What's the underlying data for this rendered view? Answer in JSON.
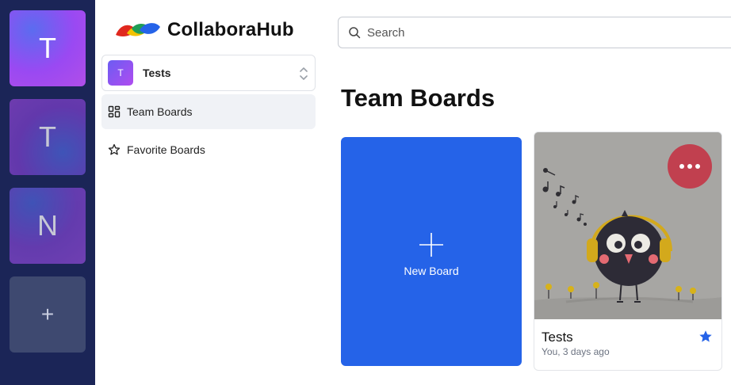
{
  "orgs": [
    {
      "initial": "T"
    },
    {
      "initial": "T"
    },
    {
      "initial": "N"
    }
  ],
  "add_org_symbol": "+",
  "brand": {
    "name": "CollaboraHub"
  },
  "current_org": {
    "initial": "T",
    "name": "Tests"
  },
  "nav": [
    {
      "label": "Team Boards",
      "icon": "dashboard-icon",
      "active": true
    },
    {
      "label": "Favorite Boards",
      "icon": "star-icon",
      "active": false
    }
  ],
  "search": {
    "placeholder": "Search",
    "value": ""
  },
  "page": {
    "title": "Team Boards"
  },
  "new_board": {
    "label": "New Board",
    "icon": "plus-icon",
    "color": "#2563e8"
  },
  "boards": [
    {
      "name": "Tests",
      "meta": "You, 3 days ago",
      "favorite": true,
      "star_color": "#2563e8",
      "menu_color": "#c1404f"
    }
  ],
  "colors": {
    "rail": "#1b2557",
    "accent": "#2563e8"
  }
}
